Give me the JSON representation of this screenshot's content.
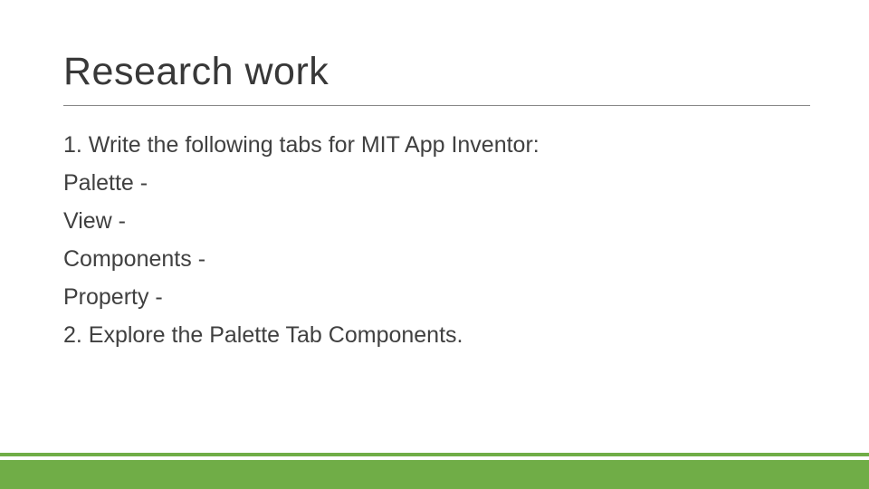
{
  "title": "Research work",
  "body": {
    "line1": "1. Write the following tabs for MIT App Inventor:",
    "line2": "Palette -",
    "line3": "View -",
    "line4": "Components -",
    "line5": "Property -",
    "line6": "2. Explore the Palette Tab Components."
  }
}
